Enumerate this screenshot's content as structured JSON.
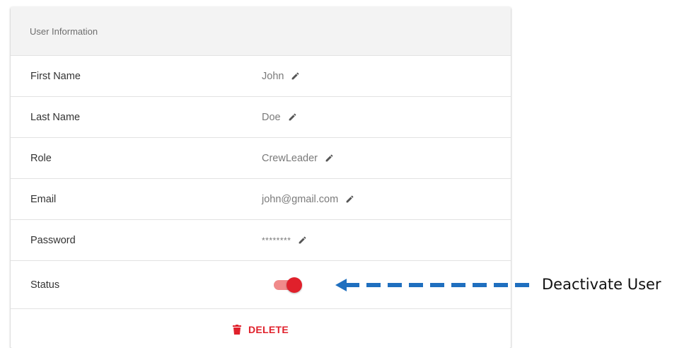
{
  "card": {
    "header_title": "User Information",
    "fields": [
      {
        "label": "First Name",
        "value": "John",
        "edit_icon": "pencil-icon"
      },
      {
        "label": "Last Name",
        "value": "Doe",
        "edit_icon": "pencil-icon"
      },
      {
        "label": "Role",
        "value": "CrewLeader",
        "edit_icon": "pencil-icon"
      },
      {
        "label": "Email",
        "value": "john@gmail.com",
        "edit_icon": "pencil-icon"
      },
      {
        "label": "Password",
        "value": "********",
        "edit_icon": "pencil-icon"
      }
    ],
    "status": {
      "label": "Status",
      "toggle_on": true,
      "toggle_color": "#e0202b"
    },
    "delete": {
      "label": "DELETE",
      "icon": "trash-icon",
      "color": "#e0202b"
    }
  },
  "annotation": {
    "text": "Deactivate User",
    "arrow_color": "#1f6fbf",
    "arrow_icon": "dashed-arrow-left"
  }
}
